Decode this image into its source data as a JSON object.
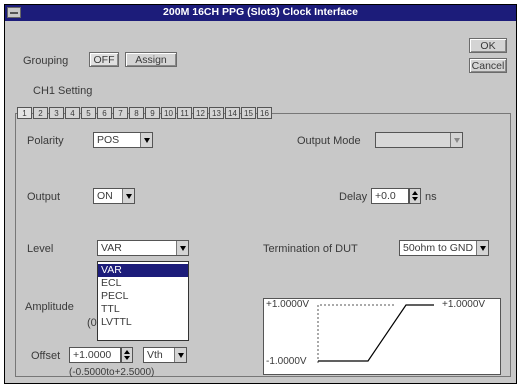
{
  "window": {
    "title": "200M 16CH PPG (Slot3) Clock Interface"
  },
  "buttons": {
    "ok": "OK",
    "cancel": "Cancel"
  },
  "grouping": {
    "label": "Grouping",
    "state": "OFF",
    "assign": "Assign"
  },
  "ch_setting": {
    "label": "CH1 Setting",
    "tabs": [
      "1",
      "2",
      "3",
      "4",
      "5",
      "6",
      "7",
      "8",
      "9",
      "10",
      "11",
      "12",
      "13",
      "14",
      "15",
      "16"
    ],
    "active": "1"
  },
  "polarity": {
    "label": "Polarity",
    "value": "POS"
  },
  "output_mode": {
    "label": "Output Mode",
    "value": ""
  },
  "output": {
    "label": "Output",
    "value": "ON"
  },
  "delay": {
    "label": "Delay",
    "value": "+0.0",
    "unit": "ns"
  },
  "level": {
    "label": "Level",
    "value": "VAR",
    "options": [
      "VAR",
      "ECL",
      "PECL",
      "TTL",
      "LVTTL"
    ],
    "selected": "VAR"
  },
  "termination": {
    "label": "Termination of DUT",
    "value": "50ohm to GND"
  },
  "amplitude": {
    "label": "Amplitude",
    "partial": "(0"
  },
  "offset": {
    "label": "Offset",
    "value": "+1.0000",
    "ref": "Vth",
    "range": "(-0.5000to+2.5000)"
  },
  "graph": {
    "high": "+1.0000V",
    "low": "-1.0000V",
    "level_right": "+1.0000V"
  }
}
